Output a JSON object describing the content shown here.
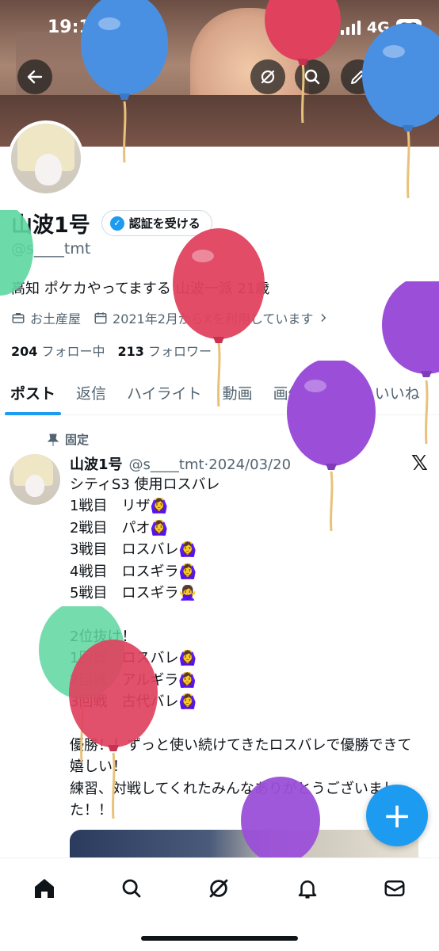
{
  "status_bar": {
    "time": "19:19",
    "network": "4G",
    "battery": "88"
  },
  "profile": {
    "display_name": "山波1号",
    "verify_button": "認証を受ける",
    "handle": "@s____tmt",
    "bio": "高知 ポケカやってまする 山波一派 21歳",
    "category": "お土産屋",
    "joined": "2021年2月からXを利用しています",
    "following_count": "204",
    "following_label": "フォロー中",
    "followers_count": "213",
    "followers_label": "フォロワー"
  },
  "tabs": [
    "ポスト",
    "返信",
    "ハイライト",
    "動画",
    "画像",
    "記事",
    "いいね"
  ],
  "tweet": {
    "pinned_label": "固定",
    "author": "山波1号",
    "handle_date": "@s____tmt·2024/03/20",
    "lines": [
      "シティS3 使用ロスバレ",
      "1戦目　リザ🙆‍♀️",
      "2戦目　パオ🙆‍♀️",
      "3戦目　ロスバレ🙆‍♀️",
      "4戦目　ロスギラ🙆‍♀️",
      "5戦目　ロスギラ🙅‍♀️",
      "",
      "2位抜け！",
      "1回戦　ロスバレ🙆‍♀️",
      "2回戦　アルギラ🙆‍♀️",
      "3回戦　古代バレ🙆‍♀️",
      "",
      "優勝！！ずっと使い続けてきたロスバレで優勝できて嬉しい！",
      "練習、対戦してくれたみんなありがとうございました！！"
    ]
  },
  "fab_label": "+",
  "x_logo": "𝕏",
  "icons": {
    "back": "back-arrow-icon",
    "grok": "grok-icon",
    "search": "search-icon",
    "edit": "edit-icon",
    "share": "share-icon",
    "briefcase": "briefcase-icon",
    "calendar": "calendar-icon",
    "pin": "pin-icon"
  },
  "colors": {
    "accent": "#1d9bf0",
    "text": "#0f1419",
    "muted": "#536471"
  }
}
